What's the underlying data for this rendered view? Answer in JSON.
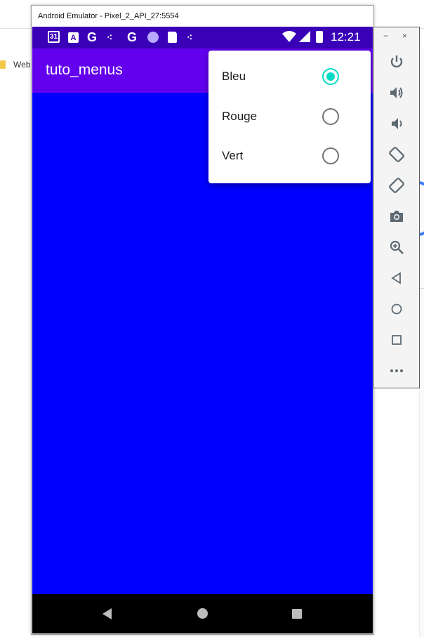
{
  "browser": {
    "bookmark_label": "Web"
  },
  "emulator": {
    "window_title": "Android Emulator - Pixel_2_API_27:5554",
    "toolbar": {
      "minimize_label": "−",
      "close_label": "×"
    }
  },
  "status_bar": {
    "calendar_day": "31",
    "time": "12:21"
  },
  "app": {
    "title": "tuto_menus",
    "content_color": "#0000ff",
    "appbar_color": "#6200ee"
  },
  "menu": {
    "items": [
      {
        "label": "Bleu",
        "checked": true
      },
      {
        "label": "Rouge",
        "checked": false
      },
      {
        "label": "Vert",
        "checked": false
      }
    ]
  },
  "colors": {
    "accent": "#03dac5",
    "status_bar": "#3a00b8"
  }
}
